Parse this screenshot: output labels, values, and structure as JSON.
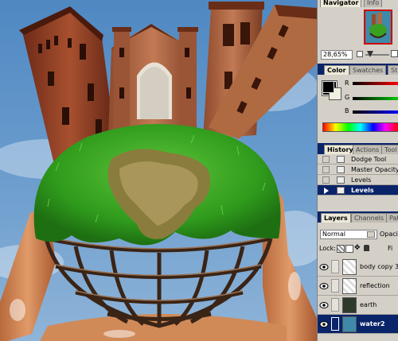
{
  "navigator": {
    "tab_navigator": "Navigator",
    "tab_info": "Info",
    "zoom": "28,65%"
  },
  "color": {
    "tab_color": "Color",
    "tab_swatches": "Swatches",
    "tab_styles": "St",
    "r": "R",
    "g": "G",
    "b": "B"
  },
  "history": {
    "tab_history": "History",
    "tab_actions": "Actions",
    "tab_tool": "Tool P",
    "items": [
      "Dodge Tool",
      "Master Opacity C",
      "Levels",
      "Levels"
    ]
  },
  "layers": {
    "tab_layers": "Layers",
    "tab_channels": "Channels",
    "tab_paths": "Pat",
    "blend_mode": "Normal",
    "opacity_label": "Opacity",
    "lock_label": "Lock:",
    "fill_label": "Fi",
    "items": [
      "body copy 3",
      "reflection",
      "earth",
      "water2"
    ]
  },
  "colors": {
    "title_bar": "#0a246a",
    "panel_bg": "#d4d0c8",
    "sky": "#5b8fc2",
    "grass": "#3aa022"
  }
}
